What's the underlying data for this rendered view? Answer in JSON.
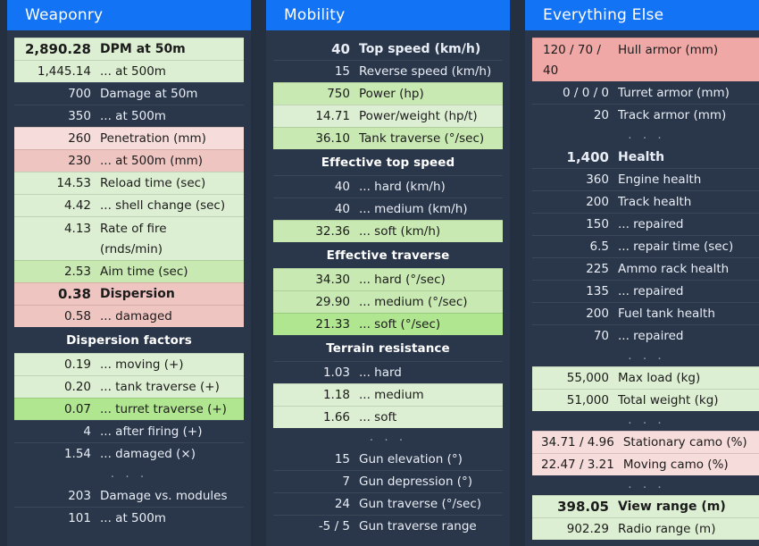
{
  "columns": [
    {
      "title": "Weaponry",
      "rows": [
        {
          "kind": "row",
          "value": "2,890.28",
          "label": "DPM at 50m",
          "style": "bg-green-1",
          "bold": true
        },
        {
          "kind": "row",
          "value": "1,445.14",
          "label": "... at 500m",
          "style": "bg-green-1",
          "bold": false
        },
        {
          "kind": "row",
          "value": "700",
          "label": "Damage at 50m",
          "style": "plain",
          "bold": false
        },
        {
          "kind": "row",
          "value": "350",
          "label": "... at 500m",
          "style": "plain",
          "bold": false
        },
        {
          "kind": "row",
          "value": "260",
          "label": "Penetration (mm)",
          "style": "bg-pink-1",
          "bold": false
        },
        {
          "kind": "row",
          "value": "230",
          "label": "... at 500m (mm)",
          "style": "bg-pink-2",
          "bold": false
        },
        {
          "kind": "row",
          "value": "14.53",
          "label": "Reload time (sec)",
          "style": "bg-green-1",
          "bold": false
        },
        {
          "kind": "row",
          "value": "4.42",
          "label": "... shell change (sec)",
          "style": "bg-green-1",
          "bold": false
        },
        {
          "kind": "row2",
          "value": "4.13",
          "label": "Rate of fire",
          "label2": "(rnds/min)",
          "style": "bg-green-1",
          "bold": false
        },
        {
          "kind": "row",
          "value": "2.53",
          "label": "Aim time (sec)",
          "style": "bg-green-2",
          "bold": false
        },
        {
          "kind": "row",
          "value": "0.38",
          "label": "Dispersion",
          "style": "bg-pink-2",
          "bold": true
        },
        {
          "kind": "row",
          "value": "0.58",
          "label": "... damaged",
          "style": "bg-pink-2",
          "bold": false
        },
        {
          "kind": "section",
          "label": "Dispersion factors"
        },
        {
          "kind": "row",
          "value": "0.19",
          "label": "... moving (+)",
          "style": "bg-green-1",
          "bold": false
        },
        {
          "kind": "row",
          "value": "0.20",
          "label": "... tank traverse (+)",
          "style": "bg-green-1",
          "bold": false
        },
        {
          "kind": "row",
          "value": "0.07",
          "label": "... turret traverse (+)",
          "style": "bg-green-3",
          "bold": false
        },
        {
          "kind": "row",
          "value": "4",
          "label": "... after firing (+)",
          "style": "plain",
          "bold": false
        },
        {
          "kind": "row",
          "value": "1.54",
          "label": "... damaged (×)",
          "style": "plain",
          "bold": false
        },
        {
          "kind": "ellipsis",
          "label": ". . ."
        },
        {
          "kind": "row",
          "value": "203",
          "label": "Damage vs. modules",
          "style": "none",
          "bold": false
        },
        {
          "kind": "row",
          "value": "101",
          "label": "... at 500m",
          "style": "plain",
          "bold": false
        }
      ]
    },
    {
      "title": "Mobility",
      "rows": [
        {
          "kind": "row",
          "value": "40",
          "label": "Top speed (km/h)",
          "style": "none",
          "bold": true
        },
        {
          "kind": "row",
          "value": "15",
          "label": "Reverse speed (km/h)",
          "style": "plain",
          "bold": false
        },
        {
          "kind": "row",
          "value": "750",
          "label": "Power (hp)",
          "style": "bg-green-2",
          "bold": false
        },
        {
          "kind": "row",
          "value": "14.71",
          "label": "Power/weight (hp/t)",
          "style": "bg-green-1",
          "bold": false
        },
        {
          "kind": "row",
          "value": "36.10",
          "label": "Tank traverse (°/sec)",
          "style": "bg-green-2",
          "bold": false
        },
        {
          "kind": "section",
          "label": "Effective top speed"
        },
        {
          "kind": "row",
          "value": "40",
          "label": "... hard (km/h)",
          "style": "plain",
          "bold": false
        },
        {
          "kind": "row",
          "value": "40",
          "label": "... medium (km/h)",
          "style": "plain",
          "bold": false
        },
        {
          "kind": "row",
          "value": "32.36",
          "label": "... soft (km/h)",
          "style": "bg-green-2",
          "bold": false
        },
        {
          "kind": "section",
          "label": "Effective traverse"
        },
        {
          "kind": "row",
          "value": "34.30",
          "label": "... hard (°/sec)",
          "style": "bg-green-2",
          "bold": false
        },
        {
          "kind": "row",
          "value": "29.90",
          "label": "... medium (°/sec)",
          "style": "bg-green-2",
          "bold": false
        },
        {
          "kind": "row",
          "value": "21.33",
          "label": "... soft (°/sec)",
          "style": "bg-green-3",
          "bold": false
        },
        {
          "kind": "section",
          "label": "Terrain resistance"
        },
        {
          "kind": "row",
          "value": "1.03",
          "label": "... hard",
          "style": "plain",
          "bold": false
        },
        {
          "kind": "row",
          "value": "1.18",
          "label": "... medium",
          "style": "bg-green-1",
          "bold": false
        },
        {
          "kind": "row",
          "value": "1.66",
          "label": "... soft",
          "style": "bg-green-1",
          "bold": false
        },
        {
          "kind": "ellipsis",
          "label": ". . ."
        },
        {
          "kind": "row",
          "value": "15",
          "label": "Gun elevation (°)",
          "style": "none",
          "bold": false
        },
        {
          "kind": "row",
          "value": "7",
          "label": "Gun depression (°)",
          "style": "plain",
          "bold": false
        },
        {
          "kind": "row",
          "value": "24",
          "label": "Gun traverse (°/sec)",
          "style": "plain",
          "bold": false
        },
        {
          "kind": "row",
          "value": "-5 / 5",
          "label": "Gun traverse range",
          "style": "plain",
          "bold": false
        }
      ]
    },
    {
      "title": "Everything Else",
      "rows": [
        {
          "kind": "wrap",
          "value": "120 / 70 / 40",
          "label": "Hull armor (mm)",
          "style": "bg-pink-3",
          "bold": false
        },
        {
          "kind": "row",
          "value": "0 / 0 / 0",
          "label": "Turret armor (mm)",
          "style": "none",
          "bold": false
        },
        {
          "kind": "row",
          "value": "20",
          "label": "Track armor (mm)",
          "style": "plain",
          "bold": false
        },
        {
          "kind": "ellipsis",
          "label": ". . ."
        },
        {
          "kind": "row",
          "value": "1,400",
          "label": "Health",
          "style": "none",
          "bold": true
        },
        {
          "kind": "row",
          "value": "360",
          "label": "Engine health",
          "style": "plain",
          "bold": false
        },
        {
          "kind": "row",
          "value": "200",
          "label": "Track health",
          "style": "plain",
          "bold": false
        },
        {
          "kind": "row",
          "value": "150",
          "label": "... repaired",
          "style": "plain",
          "bold": false
        },
        {
          "kind": "row",
          "value": "6.5",
          "label": "... repair time (sec)",
          "style": "plain",
          "bold": false
        },
        {
          "kind": "row",
          "value": "225",
          "label": "Ammo rack health",
          "style": "plain",
          "bold": false
        },
        {
          "kind": "row",
          "value": "135",
          "label": "... repaired",
          "style": "plain",
          "bold": false
        },
        {
          "kind": "row",
          "value": "200",
          "label": "Fuel tank health",
          "style": "plain",
          "bold": false
        },
        {
          "kind": "row",
          "value": "70",
          "label": "... repaired",
          "style": "plain",
          "bold": false
        },
        {
          "kind": "ellipsis",
          "label": ". . ."
        },
        {
          "kind": "row",
          "value": "55,000",
          "label": "Max load (kg)",
          "style": "bg-green-1",
          "bold": false
        },
        {
          "kind": "row",
          "value": "51,000",
          "label": "Total weight (kg)",
          "style": "bg-green-1",
          "bold": false
        },
        {
          "kind": "ellipsis",
          "label": ". . ."
        },
        {
          "kind": "wideval",
          "value": "34.71 / 4.96",
          "label": "Stationary camo (%)",
          "style": "bg-pink-1",
          "bold": false
        },
        {
          "kind": "wideval",
          "value": "22.47 / 3.21",
          "label": "Moving camo (%)",
          "style": "bg-pink-1",
          "bold": false
        },
        {
          "kind": "ellipsis",
          "label": ". . ."
        },
        {
          "kind": "row",
          "value": "398.05",
          "label": "View range (m)",
          "style": "bg-green-1",
          "bold": true
        },
        {
          "kind": "row",
          "value": "902.29",
          "label": "Radio range (m)",
          "style": "bg-green-1",
          "bold": false
        }
      ]
    }
  ],
  "colors": {
    "header_blue": "#1273f5",
    "panel_bg": "#2a3649",
    "page_bg": "#242f3f",
    "green_light": "#ddefd2",
    "green_mid": "#c9e9b3",
    "green_bright": "#b0e68f",
    "pink_light": "#f6dcda",
    "pink_mid": "#efc5c2",
    "pink_strong": "#f0a8a6",
    "text_light": "#e9eef6",
    "text_dark": "#1b1b1b"
  }
}
